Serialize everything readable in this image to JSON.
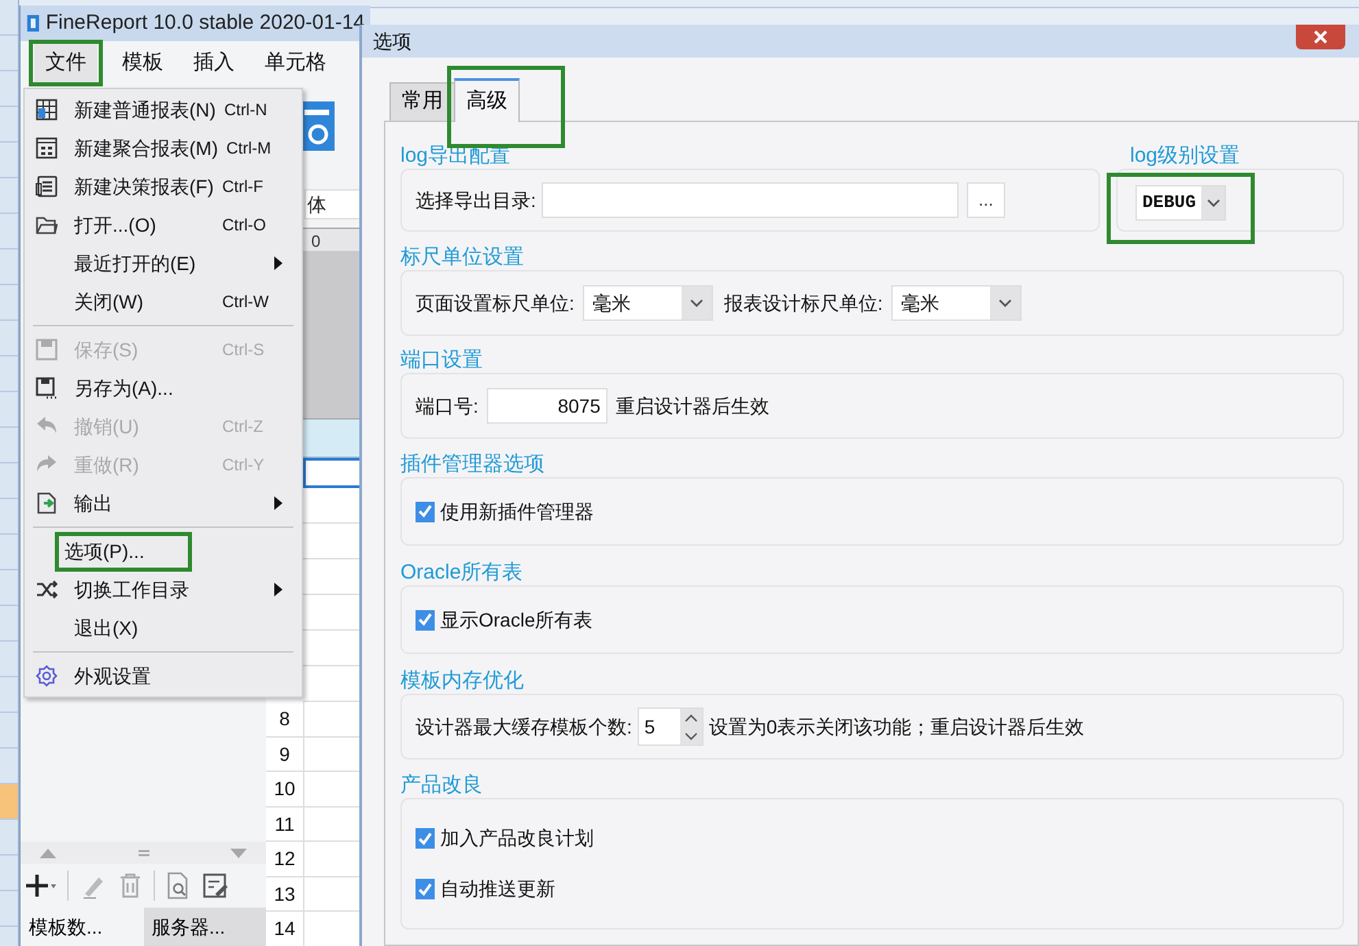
{
  "app": {
    "title": "FineReport 10.0 stable 2020-01-14",
    "menus": [
      {
        "label": "文件",
        "selected": true,
        "highlighted": true
      },
      {
        "label": "模板",
        "selected": false,
        "highlighted": false
      },
      {
        "label": "插入",
        "selected": false,
        "highlighted": false
      },
      {
        "label": "单元格",
        "selected": false,
        "highlighted": false
      }
    ],
    "font_field": "体",
    "ruler_mark": "0",
    "row_numbers": [
      "8",
      "9",
      "10",
      "11",
      "12",
      "13",
      "14"
    ],
    "panel_tabs": [
      {
        "label": "模板数...",
        "selected": true
      },
      {
        "label": "服务器...",
        "selected": false
      }
    ]
  },
  "file_menu": {
    "items": [
      {
        "label": "新建普通报表(N)",
        "shortcut": "Ctrl-N",
        "disabled": false,
        "submenu": false,
        "separator_before": false,
        "highlighted": false
      },
      {
        "label": "新建聚合报表(M)",
        "shortcut": "Ctrl-M",
        "disabled": false,
        "submenu": false,
        "separator_before": false,
        "highlighted": false
      },
      {
        "label": "新建决策报表(F)",
        "shortcut": "Ctrl-F",
        "disabled": false,
        "submenu": false,
        "separator_before": false,
        "highlighted": false
      },
      {
        "label": "打开...(O)",
        "shortcut": "Ctrl-O",
        "disabled": false,
        "submenu": false,
        "separator_before": false,
        "highlighted": false
      },
      {
        "label": "最近打开的(E)",
        "disabled": false,
        "submenu": true,
        "separator_before": false,
        "highlighted": false
      },
      {
        "label": "关闭(W)",
        "shortcut": "Ctrl-W",
        "disabled": false,
        "submenu": false,
        "separator_before": false,
        "highlighted": false
      },
      {
        "label": "保存(S)",
        "shortcut": "Ctrl-S",
        "disabled": true,
        "submenu": false,
        "separator_before": true,
        "highlighted": false
      },
      {
        "label": "另存为(A)...",
        "disabled": false,
        "submenu": false,
        "separator_before": false,
        "highlighted": false
      },
      {
        "label": "撤销(U)",
        "shortcut": "Ctrl-Z",
        "disabled": true,
        "submenu": false,
        "separator_before": false,
        "highlighted": false
      },
      {
        "label": "重做(R)",
        "shortcut": "Ctrl-Y",
        "disabled": true,
        "submenu": false,
        "separator_before": false,
        "highlighted": false
      },
      {
        "label": "输出",
        "disabled": false,
        "submenu": true,
        "separator_before": false,
        "highlighted": false
      },
      {
        "label": "选项(P)...",
        "disabled": false,
        "submenu": false,
        "separator_before": true,
        "highlighted": true
      },
      {
        "label": "切换工作目录",
        "disabled": false,
        "submenu": true,
        "separator_before": false,
        "highlighted": false
      },
      {
        "label": "退出(X)",
        "disabled": false,
        "submenu": false,
        "separator_before": false,
        "highlighted": false
      },
      {
        "label": "外观设置",
        "disabled": false,
        "submenu": false,
        "separator_before": true,
        "highlighted": false
      }
    ]
  },
  "dialog": {
    "title": "选项",
    "tabs": [
      {
        "label": "常用",
        "selected": false,
        "highlighted": false
      },
      {
        "label": "高级",
        "selected": true,
        "highlighted": true
      }
    ],
    "log_export": {
      "heading": "log导出配置",
      "label": "选择导出目录:",
      "browse": "..."
    },
    "log_level": {
      "heading": "log级别设置",
      "value": "DEBUG",
      "highlighted": true
    },
    "ruler": {
      "heading": "标尺单位设置",
      "fields": [
        {
          "label": "页面设置标尺单位:",
          "value": "毫米"
        },
        {
          "label": "报表设计标尺单位:",
          "value": "毫米"
        }
      ]
    },
    "port": {
      "heading": "端口设置",
      "label": "端口号:",
      "value": "8075",
      "note": "重启设计器后生效"
    },
    "plugin": {
      "heading": "插件管理器选项",
      "checkboxes": [
        {
          "label": "使用新插件管理器",
          "checked": true
        }
      ]
    },
    "oracle": {
      "heading": "Oracle所有表",
      "checkboxes": [
        {
          "label": "显示Oracle所有表",
          "checked": true
        }
      ]
    },
    "cache": {
      "heading": "模板内存优化",
      "label": "设计器最大缓存模板个数:",
      "value": "5",
      "note": "设置为0表示关闭该功能；重启设计器后生效"
    },
    "improve": {
      "heading": "产品改良",
      "checkboxes": [
        {
          "label": "加入产品改良计划",
          "checked": true
        },
        {
          "label": "自动推送更新",
          "checked": true
        }
      ]
    }
  }
}
